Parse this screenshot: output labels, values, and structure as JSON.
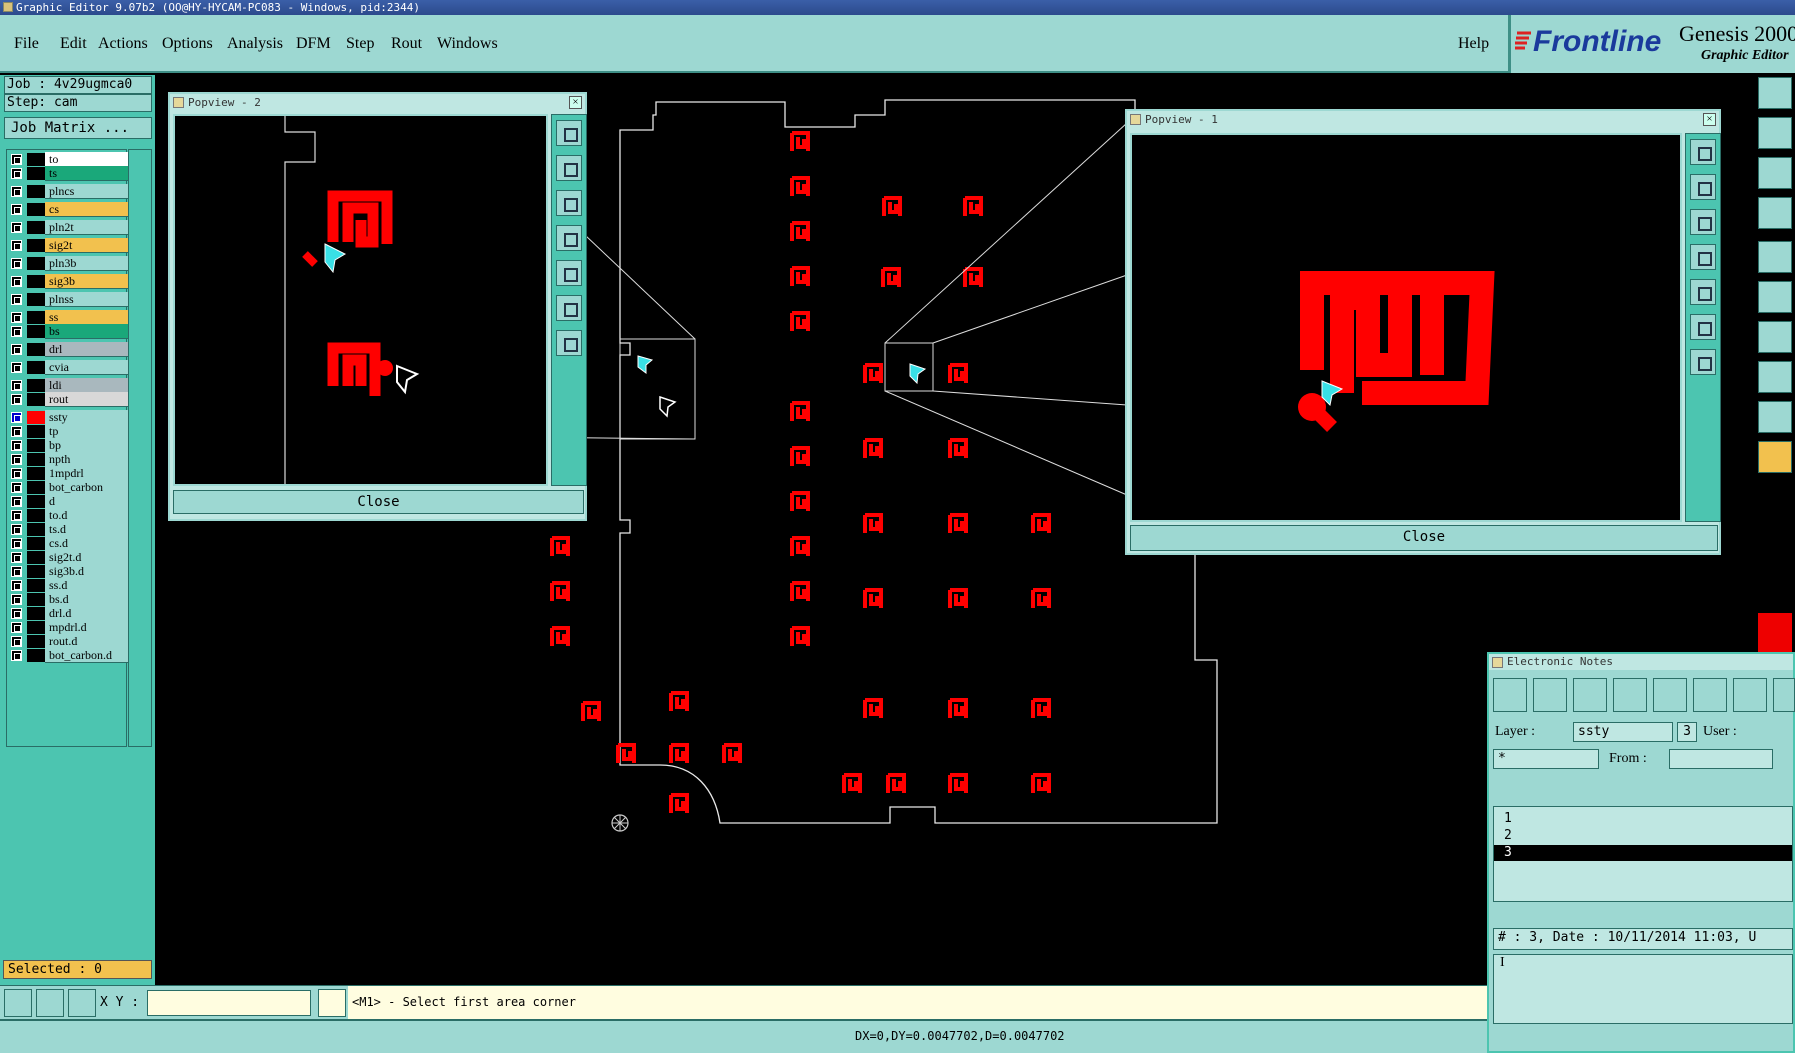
{
  "window": {
    "title": "Graphic Editor 9.07b2 (OO@HY-HYCAM-PC083 - Windows, pid:2344)"
  },
  "menu": [
    "File",
    "Edit",
    "Actions",
    "Options",
    "Analysis",
    "DFM",
    "Step",
    "Rout",
    "Windows"
  ],
  "help_label": "Help",
  "brand": {
    "logo": "Frontline",
    "product": "Genesis 2000",
    "subtitle": "Graphic Editor"
  },
  "job": {
    "job_label": "Job : 4v29ugmca0",
    "step_label": "Step: cam",
    "matrix_button": "Job Matrix ..."
  },
  "layers": [
    {
      "name": "to",
      "color": "#ffffff"
    },
    {
      "name": "ts",
      "color": "#1aa87a"
    },
    {
      "name": "plncs",
      "color": "#9dd8d2"
    },
    {
      "name": "cs",
      "color": "#f2c14e"
    },
    {
      "name": "pln2t",
      "color": "#9dd8d2"
    },
    {
      "name": "sig2t",
      "color": "#f2c14e"
    },
    {
      "name": "pln3b",
      "color": "#9dd8d2"
    },
    {
      "name": "sig3b",
      "color": "#f2c14e"
    },
    {
      "name": "plnss",
      "color": "#9dd8d2"
    },
    {
      "name": "ss",
      "color": "#f2c14e"
    },
    {
      "name": "bs",
      "color": "#1aa87a"
    },
    {
      "name": "drl",
      "color": "#a9b8be"
    },
    {
      "name": "cvia",
      "color": "#9dd8d2"
    },
    {
      "name": "ldi",
      "color": "#a9b8be"
    },
    {
      "name": "rout",
      "color": "#d8d8d8"
    },
    {
      "name": "ssty",
      "color": "#9dd8d2",
      "active": true
    },
    {
      "name": "tp",
      "color": "#9dd8d2"
    },
    {
      "name": "bp",
      "color": "#9dd8d2"
    },
    {
      "name": "npth",
      "color": "#9dd8d2"
    },
    {
      "name": "1mpdrl",
      "color": "#9dd8d2"
    },
    {
      "name": "bot_carbon",
      "color": "#9dd8d2"
    },
    {
      "name": "d",
      "color": "#9dd8d2"
    },
    {
      "name": "to.d",
      "color": "#9dd8d2"
    },
    {
      "name": "ts.d",
      "color": "#9dd8d2"
    },
    {
      "name": "cs.d",
      "color": "#9dd8d2"
    },
    {
      "name": "sig2t.d",
      "color": "#9dd8d2"
    },
    {
      "name": "sig3b.d",
      "color": "#9dd8d2"
    },
    {
      "name": "ss.d",
      "color": "#9dd8d2"
    },
    {
      "name": "bs.d",
      "color": "#9dd8d2"
    },
    {
      "name": "drl.d",
      "color": "#9dd8d2"
    },
    {
      "name": "mpdrl.d",
      "color": "#9dd8d2"
    },
    {
      "name": "rout.d",
      "color": "#9dd8d2"
    },
    {
      "name": "bot_carbon.d",
      "color": "#9dd8d2"
    }
  ],
  "selected": "Selected : 0",
  "popview2": {
    "title": "Popview - 2",
    "close": "Close"
  },
  "popview1": {
    "title": "Popview - 1",
    "close": "Close"
  },
  "enotes": {
    "title": "Electronic Notes",
    "layer_label": "Layer :",
    "layer_value": "ssty",
    "layer_num": "3",
    "user_label": "User :",
    "star_value": "*",
    "from_label": "From :",
    "notes": [
      "1",
      "2",
      "3"
    ],
    "selected_note": "3",
    "info": "# : 3, Date : 10/11/2014 11:03, U",
    "cursor": "I"
  },
  "command": {
    "xy_label": "X Y :",
    "xy_value": "",
    "prompt": "<M1> - Select first area corner"
  },
  "status": "DX=0,DY=0.0047702,D=0.0047702",
  "colors": {
    "teal": "#4cc5b0",
    "light_teal": "#9dd8d2",
    "pad_red": "#ff0000",
    "cursor_cyan": "#39e0e6"
  }
}
